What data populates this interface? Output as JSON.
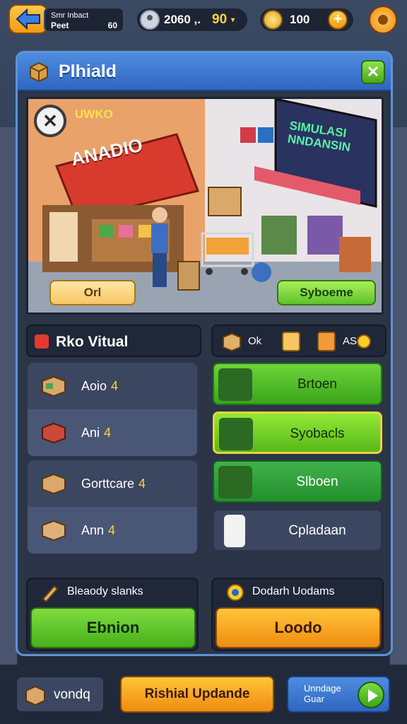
{
  "topbar": {
    "profile_line1": "Smr Inbact",
    "profile_line2a": "Peet",
    "profile_line2b": "60",
    "currency1_value": "2060 ,.",
    "currency1_count": "90",
    "currency1_dropdown": "▾",
    "currency2_value": "100",
    "plus_label": "+"
  },
  "panel": {
    "title": "Plhiald",
    "close_label": "✕"
  },
  "scene": {
    "shop_sign": "ANADIO",
    "promo_label": "UWKO",
    "store_sign": "SIMULASI\nNNDANSIN",
    "left_button": "Orl",
    "right_button": "Syboeme",
    "close_label": "✕"
  },
  "left_section": {
    "title": "Rko Vitual",
    "rows": [
      {
        "label": "Aoio",
        "qty": "4"
      },
      {
        "label": "Ani",
        "qty": "4"
      },
      {
        "label": "Gorttcare",
        "qty": "4"
      },
      {
        "label": "Ann",
        "qty": "4"
      }
    ]
  },
  "right_section": {
    "label_a": "Ok",
    "label_b": "AS",
    "buttons": [
      {
        "label": "Brtoen"
      },
      {
        "label": "Syobacls"
      },
      {
        "label": "Slboen"
      },
      {
        "label": "Cpladaan"
      }
    ]
  },
  "bottom_left": {
    "header": "Bleaody slanks",
    "button": "Ebnion"
  },
  "bottom_right": {
    "header": "Dodarh Uodams",
    "button": "Loodo"
  },
  "footer": {
    "left_label": "vondq",
    "middle_label": "Rishial Updande",
    "right_line1": "Unndage",
    "right_line2": "Guar"
  },
  "colors": {
    "panel_header": "#2e66c0",
    "green_button": "#47b01c",
    "orange_button": "#f08c10",
    "currency_gold": "#ffd43a"
  }
}
